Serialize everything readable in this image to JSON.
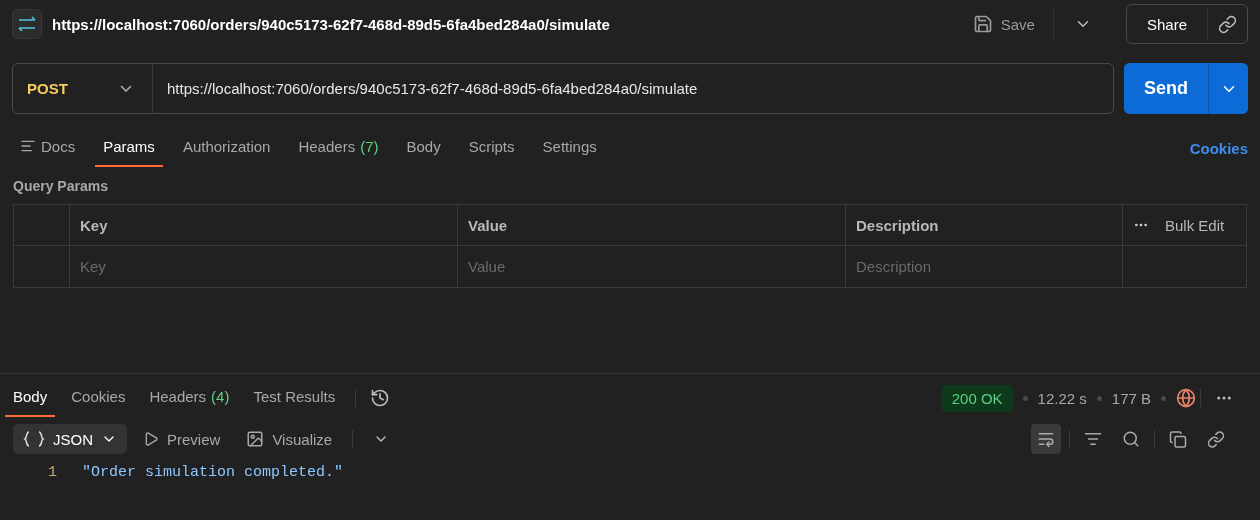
{
  "title": "https://localhost:7060/orders/940c5173-62f7-468d-89d5-6fa4bed284a0/simulate",
  "header_actions": {
    "save": "Save",
    "share": "Share"
  },
  "request": {
    "method": "POST",
    "url": "https://localhost:7060/orders/940c5173-62f7-468d-89d5-6fa4bed284a0/simulate",
    "send": "Send"
  },
  "request_tabs": [
    {
      "label": "Docs",
      "kind": "docs",
      "selected": false
    },
    {
      "label": "Params",
      "selected": true,
      "kind": "plain"
    },
    {
      "label": "Authorization",
      "selected": false,
      "kind": "plain"
    },
    {
      "label": "Headers",
      "count": "(7)",
      "selected": false,
      "kind": "plain"
    },
    {
      "label": "Body",
      "selected": false,
      "kind": "plain"
    },
    {
      "label": "Scripts",
      "selected": false,
      "kind": "plain"
    },
    {
      "label": "Settings",
      "selected": false,
      "kind": "plain"
    }
  ],
  "cookies_link": "Cookies",
  "query_params": {
    "title": "Query Params",
    "columns": [
      "Key",
      "Value",
      "Description"
    ],
    "bulk_edit": "Bulk Edit",
    "placeholders": [
      "Key",
      "Value",
      "Description"
    ]
  },
  "response": {
    "tabs": [
      {
        "label": "Body",
        "selected": true
      },
      {
        "label": "Cookies",
        "selected": false
      },
      {
        "label": "Headers",
        "count": "(4)",
        "selected": false
      },
      {
        "label": "Test Results",
        "selected": false
      }
    ],
    "status": "200 OK",
    "time": "12.22 s",
    "size": "177 B",
    "format": "JSON",
    "views": [
      {
        "label": "Preview",
        "kind": "preview"
      },
      {
        "label": "Visualize",
        "kind": "visualize"
      }
    ],
    "wrap_lines": true,
    "lines": [
      {
        "number": "1",
        "text": "\"Order simulation completed.\""
      }
    ]
  }
}
